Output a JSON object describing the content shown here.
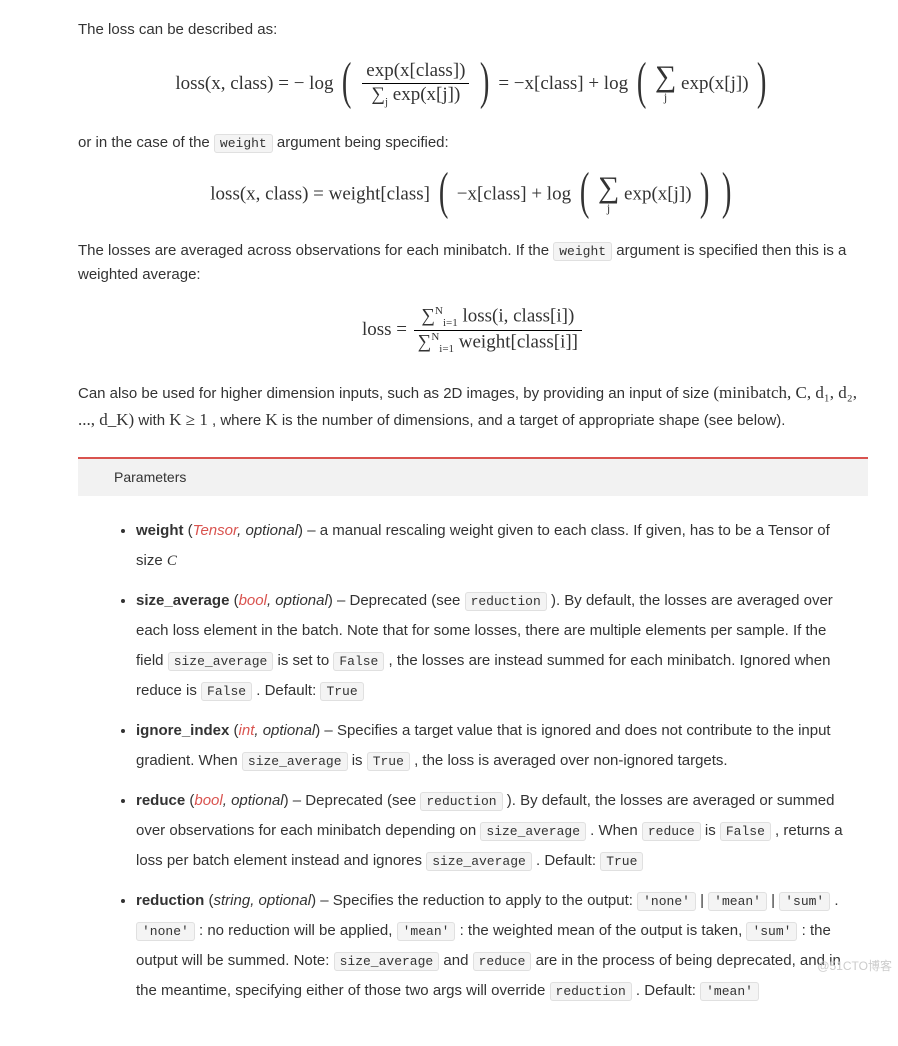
{
  "intro": {
    "p1": "The loss can be described as:",
    "p2_before": "or in the case of the ",
    "p2_code": "weight",
    "p2_after": " argument being specified:",
    "p3_before": "The losses are averaged across observations for each minibatch. If the ",
    "p3_code": "weight",
    "p3_after": " argument is specified then this is a weighted average:",
    "p4": "Can also be used for higher dimension inputs, such as 2D images, by providing an input of size ",
    "p4_math": "(minibatch, C, d₁, d₂, ..., d_K)",
    "p4_with": " with ",
    "p4_kge": "K ≥ 1",
    "p4_where": " , where ",
    "p4_k": "K",
    "p4_rest": " is the number of dimensions, and a target of appropriate shape (see below)."
  },
  "formulas": {
    "f1_lhs": "loss(x, class) = − log",
    "f1_num": "exp(x[class])",
    "f1_den_pre": "∑",
    "f1_den_sub": "j",
    "f1_den_post": " exp(x[j])",
    "f1_eq": " = −x[class] + log",
    "f1_sum_body": "exp(x[j])",
    "f2_lhs": "loss(x, class) = weight[class]",
    "f2_body": "−x[class] + log",
    "f3_lhs": "loss = ",
    "f3_num_sum": "∑",
    "f3_num_limits": "N",
    "f3_num_lower": "i=1",
    "f3_num_body": " loss(i, class[i])",
    "f3_den_body": " weight[class[i]]"
  },
  "params": {
    "header": "Parameters",
    "items": [
      {
        "name": "weight",
        "type_link": "Tensor",
        "type_rest": ", optional",
        "desc_parts": [
          {
            "t": "text",
            "v": " – a manual rescaling weight given to each class. If given, has to be a Tensor of size "
          },
          {
            "t": "ital",
            "v": "C"
          }
        ]
      },
      {
        "name": "size_average",
        "type_link": "bool",
        "type_rest": ", optional",
        "desc_parts": [
          {
            "t": "text",
            "v": " – Deprecated (see "
          },
          {
            "t": "code",
            "v": "reduction"
          },
          {
            "t": "text",
            "v": " ). By default, the losses are averaged over each loss element in the batch. Note that for some losses, there are multiple elements per sample. If the field "
          },
          {
            "t": "code",
            "v": "size_average"
          },
          {
            "t": "text",
            "v": " is set to "
          },
          {
            "t": "code",
            "v": "False"
          },
          {
            "t": "text",
            "v": " , the losses are instead summed for each minibatch. Ignored when reduce is "
          },
          {
            "t": "code",
            "v": "False"
          },
          {
            "t": "text",
            "v": " . Default: "
          },
          {
            "t": "code",
            "v": "True"
          }
        ]
      },
      {
        "name": "ignore_index",
        "type_link": "int",
        "type_rest": ", optional",
        "desc_parts": [
          {
            "t": "text",
            "v": " – Specifies a target value that is ignored and does not contribute to the input gradient. When "
          },
          {
            "t": "code",
            "v": "size_average"
          },
          {
            "t": "text",
            "v": " is "
          },
          {
            "t": "code",
            "v": "True"
          },
          {
            "t": "text",
            "v": " , the loss is averaged over non-ignored targets."
          }
        ]
      },
      {
        "name": "reduce",
        "type_link": "bool",
        "type_rest": ", optional",
        "desc_parts": [
          {
            "t": "text",
            "v": " – Deprecated (see "
          },
          {
            "t": "code",
            "v": "reduction"
          },
          {
            "t": "text",
            "v": " ). By default, the losses are averaged or summed over observations for each minibatch depending on "
          },
          {
            "t": "code",
            "v": "size_average"
          },
          {
            "t": "text",
            "v": " . When "
          },
          {
            "t": "code",
            "v": "reduce"
          },
          {
            "t": "text",
            "v": " is "
          },
          {
            "t": "code",
            "v": "False"
          },
          {
            "t": "text",
            "v": " , returns a loss per batch element instead and ignores "
          },
          {
            "t": "code",
            "v": "size_average"
          },
          {
            "t": "text",
            "v": " . Default: "
          },
          {
            "t": "code",
            "v": "True"
          }
        ]
      },
      {
        "name": "reduction",
        "type_link": "",
        "type_rest": "string, optional",
        "desc_parts": [
          {
            "t": "text",
            "v": " – Specifies the reduction to apply to the output: "
          },
          {
            "t": "code",
            "v": "'none'"
          },
          {
            "t": "text",
            "v": " | "
          },
          {
            "t": "code",
            "v": "'mean'"
          },
          {
            "t": "text",
            "v": " | "
          },
          {
            "t": "code",
            "v": "'sum'"
          },
          {
            "t": "text",
            "v": " . "
          },
          {
            "t": "code",
            "v": "'none'"
          },
          {
            "t": "text",
            "v": " : no reduction will be applied, "
          },
          {
            "t": "code",
            "v": "'mean'"
          },
          {
            "t": "text",
            "v": " : the weighted mean of the output is taken, "
          },
          {
            "t": "code",
            "v": "'sum'"
          },
          {
            "t": "text",
            "v": " : the output will be summed. Note: "
          },
          {
            "t": "code",
            "v": "size_average"
          },
          {
            "t": "text",
            "v": " and "
          },
          {
            "t": "code",
            "v": "reduce"
          },
          {
            "t": "text",
            "v": " are in the process of being deprecated, and in the meantime, specifying either of those two args will override "
          },
          {
            "t": "code",
            "v": "reduction"
          },
          {
            "t": "text",
            "v": " . Default: "
          },
          {
            "t": "code",
            "v": "'mean'"
          }
        ]
      }
    ]
  },
  "watermark": "@51CTO博客"
}
